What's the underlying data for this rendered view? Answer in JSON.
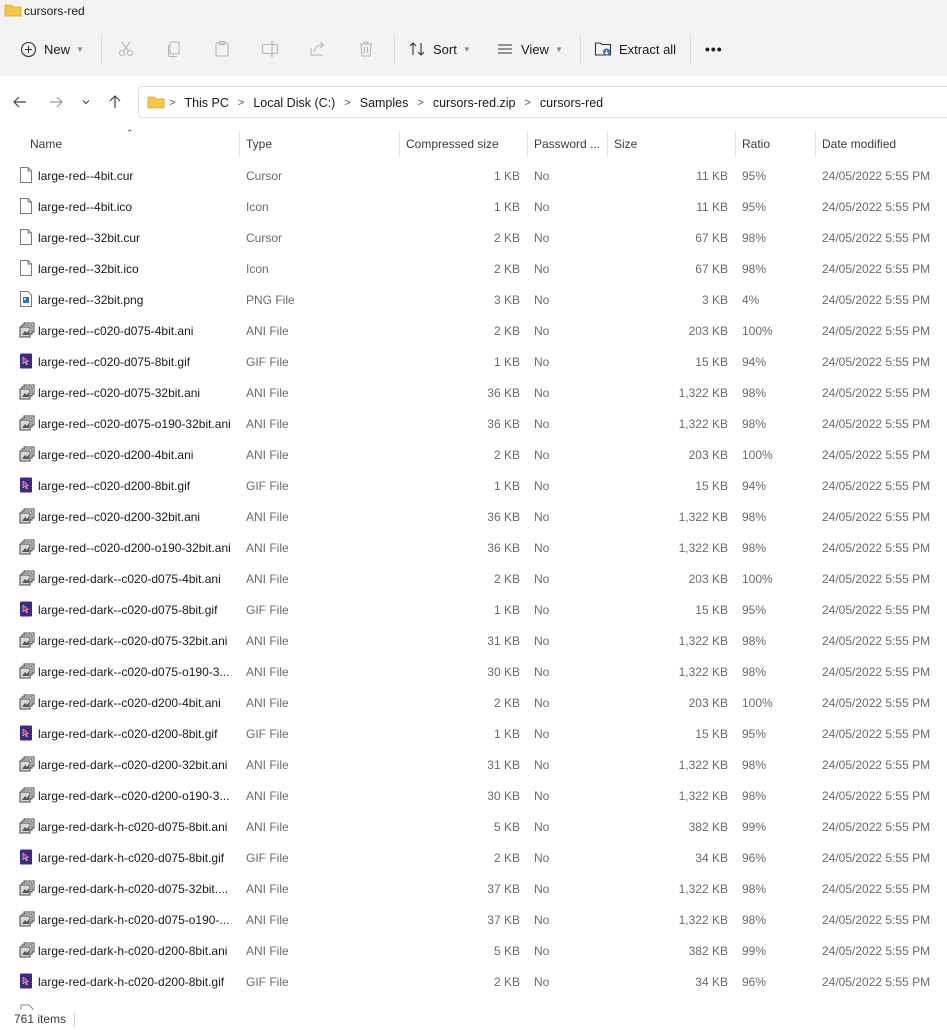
{
  "window": {
    "title": "cursors-red"
  },
  "toolbar": {
    "new_label": "New",
    "sort_label": "Sort",
    "view_label": "View",
    "extract_label": "Extract all",
    "more_label": "•••"
  },
  "address": {
    "crumbs": [
      "This PC",
      "Local Disk (C:)",
      "Samples",
      "cursors-red.zip",
      "cursors-red"
    ]
  },
  "columns": {
    "name": "Name",
    "type": "Type",
    "compressed": "Compressed size",
    "password": "Password ...",
    "size": "Size",
    "ratio": "Ratio",
    "date": "Date modified"
  },
  "files": [
    {
      "name": "large-red--4bit.cur",
      "type": "Cursor",
      "compressed": "1 KB",
      "password": "No",
      "size": "11 KB",
      "ratio": "95%",
      "date": "24/05/2022 5:55 PM",
      "icon": "generic-file-icon"
    },
    {
      "name": "large-red--4bit.ico",
      "type": "Icon",
      "compressed": "1 KB",
      "password": "No",
      "size": "11 KB",
      "ratio": "95%",
      "date": "24/05/2022 5:55 PM",
      "icon": "generic-file-icon"
    },
    {
      "name": "large-red--32bit.cur",
      "type": "Cursor",
      "compressed": "2 KB",
      "password": "No",
      "size": "67 KB",
      "ratio": "98%",
      "date": "24/05/2022 5:55 PM",
      "icon": "generic-file-icon"
    },
    {
      "name": "large-red--32bit.ico",
      "type": "Icon",
      "compressed": "2 KB",
      "password": "No",
      "size": "67 KB",
      "ratio": "98%",
      "date": "24/05/2022 5:55 PM",
      "icon": "generic-file-icon"
    },
    {
      "name": "large-red--32bit.png",
      "type": "PNG File",
      "compressed": "3 KB",
      "password": "No",
      "size": "3 KB",
      "ratio": "4%",
      "date": "24/05/2022 5:55 PM",
      "icon": "png-file-icon"
    },
    {
      "name": "large-red--c020-d075-4bit.ani",
      "type": "ANI File",
      "compressed": "2 KB",
      "password": "No",
      "size": "203 KB",
      "ratio": "100%",
      "date": "24/05/2022 5:55 PM",
      "icon": "ani-file-icon"
    },
    {
      "name": "large-red--c020-d075-8bit.gif",
      "type": "GIF File",
      "compressed": "1 KB",
      "password": "No",
      "size": "15 KB",
      "ratio": "94%",
      "date": "24/05/2022 5:55 PM",
      "icon": "gif-file-icon"
    },
    {
      "name": "large-red--c020-d075-32bit.ani",
      "type": "ANI File",
      "compressed": "36 KB",
      "password": "No",
      "size": "1,322 KB",
      "ratio": "98%",
      "date": "24/05/2022 5:55 PM",
      "icon": "ani-file-icon"
    },
    {
      "name": "large-red--c020-d075-o190-32bit.ani",
      "type": "ANI File",
      "compressed": "36 KB",
      "password": "No",
      "size": "1,322 KB",
      "ratio": "98%",
      "date": "24/05/2022 5:55 PM",
      "icon": "ani-file-icon"
    },
    {
      "name": "large-red--c020-d200-4bit.ani",
      "type": "ANI File",
      "compressed": "2 KB",
      "password": "No",
      "size": "203 KB",
      "ratio": "100%",
      "date": "24/05/2022 5:55 PM",
      "icon": "ani-file-icon"
    },
    {
      "name": "large-red--c020-d200-8bit.gif",
      "type": "GIF File",
      "compressed": "1 KB",
      "password": "No",
      "size": "15 KB",
      "ratio": "94%",
      "date": "24/05/2022 5:55 PM",
      "icon": "gif-file-icon"
    },
    {
      "name": "large-red--c020-d200-32bit.ani",
      "type": "ANI File",
      "compressed": "36 KB",
      "password": "No",
      "size": "1,322 KB",
      "ratio": "98%",
      "date": "24/05/2022 5:55 PM",
      "icon": "ani-file-icon"
    },
    {
      "name": "large-red--c020-d200-o190-32bit.ani",
      "type": "ANI File",
      "compressed": "36 KB",
      "password": "No",
      "size": "1,322 KB",
      "ratio": "98%",
      "date": "24/05/2022 5:55 PM",
      "icon": "ani-file-icon"
    },
    {
      "name": "large-red-dark--c020-d075-4bit.ani",
      "type": "ANI File",
      "compressed": "2 KB",
      "password": "No",
      "size": "203 KB",
      "ratio": "100%",
      "date": "24/05/2022 5:55 PM",
      "icon": "ani-file-icon"
    },
    {
      "name": "large-red-dark--c020-d075-8bit.gif",
      "type": "GIF File",
      "compressed": "1 KB",
      "password": "No",
      "size": "15 KB",
      "ratio": "95%",
      "date": "24/05/2022 5:55 PM",
      "icon": "gif-file-icon"
    },
    {
      "name": "large-red-dark--c020-d075-32bit.ani",
      "type": "ANI File",
      "compressed": "31 KB",
      "password": "No",
      "size": "1,322 KB",
      "ratio": "98%",
      "date": "24/05/2022 5:55 PM",
      "icon": "ani-file-icon"
    },
    {
      "name": "large-red-dark--c020-d075-o190-3...",
      "type": "ANI File",
      "compressed": "30 KB",
      "password": "No",
      "size": "1,322 KB",
      "ratio": "98%",
      "date": "24/05/2022 5:55 PM",
      "icon": "ani-file-icon"
    },
    {
      "name": "large-red-dark--c020-d200-4bit.ani",
      "type": "ANI File",
      "compressed": "2 KB",
      "password": "No",
      "size": "203 KB",
      "ratio": "100%",
      "date": "24/05/2022 5:55 PM",
      "icon": "ani-file-icon"
    },
    {
      "name": "large-red-dark--c020-d200-8bit.gif",
      "type": "GIF File",
      "compressed": "1 KB",
      "password": "No",
      "size": "15 KB",
      "ratio": "95%",
      "date": "24/05/2022 5:55 PM",
      "icon": "gif-file-icon"
    },
    {
      "name": "large-red-dark--c020-d200-32bit.ani",
      "type": "ANI File",
      "compressed": "31 KB",
      "password": "No",
      "size": "1,322 KB",
      "ratio": "98%",
      "date": "24/05/2022 5:55 PM",
      "icon": "ani-file-icon"
    },
    {
      "name": "large-red-dark--c020-d200-o190-3...",
      "type": "ANI File",
      "compressed": "30 KB",
      "password": "No",
      "size": "1,322 KB",
      "ratio": "98%",
      "date": "24/05/2022 5:55 PM",
      "icon": "ani-file-icon"
    },
    {
      "name": "large-red-dark-h-c020-d075-8bit.ani",
      "type": "ANI File",
      "compressed": "5 KB",
      "password": "No",
      "size": "382 KB",
      "ratio": "99%",
      "date": "24/05/2022 5:55 PM",
      "icon": "ani-file-icon"
    },
    {
      "name": "large-red-dark-h-c020-d075-8bit.gif",
      "type": "GIF File",
      "compressed": "2 KB",
      "password": "No",
      "size": "34 KB",
      "ratio": "96%",
      "date": "24/05/2022 5:55 PM",
      "icon": "gif-file-icon"
    },
    {
      "name": "large-red-dark-h-c020-d075-32bit....",
      "type": "ANI File",
      "compressed": "37 KB",
      "password": "No",
      "size": "1,322 KB",
      "ratio": "98%",
      "date": "24/05/2022 5:55 PM",
      "icon": "ani-file-icon"
    },
    {
      "name": "large-red-dark-h-c020-d075-o190-...",
      "type": "ANI File",
      "compressed": "37 KB",
      "password": "No",
      "size": "1,322 KB",
      "ratio": "98%",
      "date": "24/05/2022 5:55 PM",
      "icon": "ani-file-icon"
    },
    {
      "name": "large-red-dark-h-c020-d200-8bit.ani",
      "type": "ANI File",
      "compressed": "5 KB",
      "password": "No",
      "size": "382 KB",
      "ratio": "99%",
      "date": "24/05/2022 5:55 PM",
      "icon": "ani-file-icon"
    },
    {
      "name": "large-red-dark-h-c020-d200-8bit.gif",
      "type": "GIF File",
      "compressed": "2 KB",
      "password": "No",
      "size": "34 KB",
      "ratio": "96%",
      "date": "24/05/2022 5:55 PM",
      "icon": "gif-file-icon"
    }
  ],
  "status": {
    "items_count": "761 items"
  },
  "colors": {
    "folder": "#f8c645",
    "toolbar_bg": "#f3f3f3",
    "gif_icon": "#3a2a8c",
    "gif_icon_accent": "#e2242c",
    "png_icon": "#2b6fd6"
  }
}
